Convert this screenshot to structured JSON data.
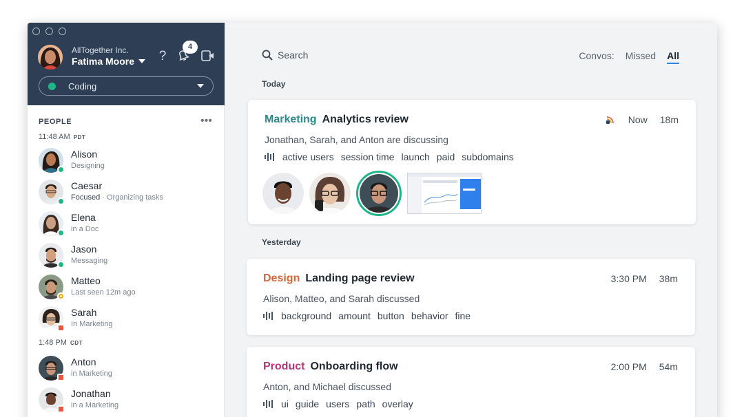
{
  "header": {
    "org": "AllTogether Inc.",
    "user_name": "Fatima Moore",
    "help_icon": "help-icon",
    "notifications_count": "4",
    "status": "Coding",
    "status_color": "#1fb587"
  },
  "people": {
    "title": "PEOPLE",
    "more_label": "•••",
    "groups": [
      {
        "time": "11:48 AM",
        "tz": "PDT"
      },
      {
        "time": "1:48 PM",
        "tz": "CDT"
      }
    ],
    "list": [
      {
        "name": "Alison",
        "sub": "Designing",
        "status": "online"
      },
      {
        "name": "Caesar",
        "focus": "Focused",
        "sub": " · Organizing tasks",
        "status": "focused"
      },
      {
        "name": "Elena",
        "sub": "in a Doc",
        "status": "online"
      },
      {
        "name": "Jason",
        "sub": "Messaging",
        "status": "online"
      },
      {
        "name": "Matteo",
        "sub": "Last seen 12m ago",
        "status": "away"
      },
      {
        "name": "Sarah",
        "sub": "In Marketing",
        "status": "meeting"
      },
      {
        "name": "Anton",
        "sub": "in Marketing",
        "status": "meeting"
      },
      {
        "name": "Jonathan",
        "sub": "in a Marketing",
        "status": "meeting"
      }
    ]
  },
  "main": {
    "search_label": "Search",
    "convos_label": "Convos:",
    "filter_missed": "Missed",
    "filter_all": "All",
    "day_today": "Today",
    "day_yesterday": "Yesterday",
    "cards": [
      {
        "category": "Marketing",
        "category_color": "#2e8a8a",
        "title": "Analytics review",
        "time": "Now",
        "duration": "18m",
        "people": "Jonathan, Sarah, and Anton are discussing",
        "tags": [
          "active users",
          "session time",
          "launch",
          "paid",
          "subdomains"
        ]
      },
      {
        "category": "Design",
        "category_color": "#d9663a",
        "title": "Landing page review",
        "time": "3:30 PM",
        "duration": "38m",
        "people": "Alison, Matteo, and Sarah discussed",
        "tags": [
          "background",
          "amount",
          "button",
          "behavior",
          "fine"
        ]
      },
      {
        "category": "Product",
        "category_color": "#b8337a",
        "title": "Onboarding flow",
        "time": "2:00 PM",
        "duration": "54m",
        "people": "Anton, and Michael discussed",
        "tags": [
          "ui",
          "guide",
          "users",
          "path",
          "overlay"
        ]
      }
    ]
  },
  "colors": {
    "online": "#1fb587",
    "away": "#e8a417",
    "meeting": "#e8573a",
    "header_bg": "#2d3e55"
  }
}
